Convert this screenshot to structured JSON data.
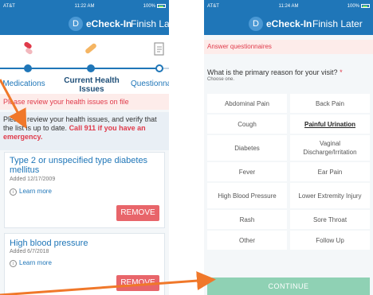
{
  "left_phone": {
    "status": {
      "carrier": "AT&T",
      "time": "11:22 AM",
      "battery": "100%"
    },
    "header": {
      "avatar": "D",
      "title": "eCheck-In",
      "action": "Finish Later"
    },
    "steps": [
      {
        "label": "Medications",
        "icon": "pill-icon"
      },
      {
        "label": "Current Health Issues",
        "icon": "bandage-icon"
      },
      {
        "label": "Questionna",
        "icon": "clipboard-icon"
      }
    ],
    "alert": "Please review your health issues on file",
    "intro": "Please review your health issues, and verify that the list is up to date.",
    "intro_warning": "Call 911 if you have an emergency.",
    "issues": [
      {
        "title": "Type 2 or unspecified type diabetes mellitus",
        "date": "Added 12/17/2009",
        "learn_more": "Learn more",
        "remove": "REMOVE"
      },
      {
        "title": "High blood pressure",
        "date": "Added 6/7/2018",
        "learn_more": "Learn more",
        "remove": "REMOVE"
      }
    ]
  },
  "right_phone": {
    "status": {
      "carrier": "AT&T",
      "time": "11:24 AM",
      "battery": "100%"
    },
    "header": {
      "avatar": "D",
      "title": "eCheck-In",
      "action": "Finish Later"
    },
    "banner": "Answer questionnaires",
    "question": "What is the primary reason for your visit?",
    "required_mark": "*",
    "choose": "Choose one.",
    "options_left": [
      "Abdominal Pain",
      "Cough",
      "Diabetes",
      "Fever",
      "High Blood Pressure",
      "Rash",
      "Other"
    ],
    "options_right": [
      "Back Pain",
      "Painful Urination",
      "Vaginal Discharge/Irritation",
      "Ear Pain",
      "Lower Extremity Injury",
      "Sore Throat",
      "Follow Up"
    ],
    "selected": "Painful Urination",
    "continue": "CONTINUE"
  },
  "colors": {
    "brand_blue": "#1f76b8",
    "alert_red": "#e03a4a",
    "remove_red": "#e8656a",
    "continue_green": "#8fd1b4",
    "arrow_orange": "#f0782a"
  }
}
